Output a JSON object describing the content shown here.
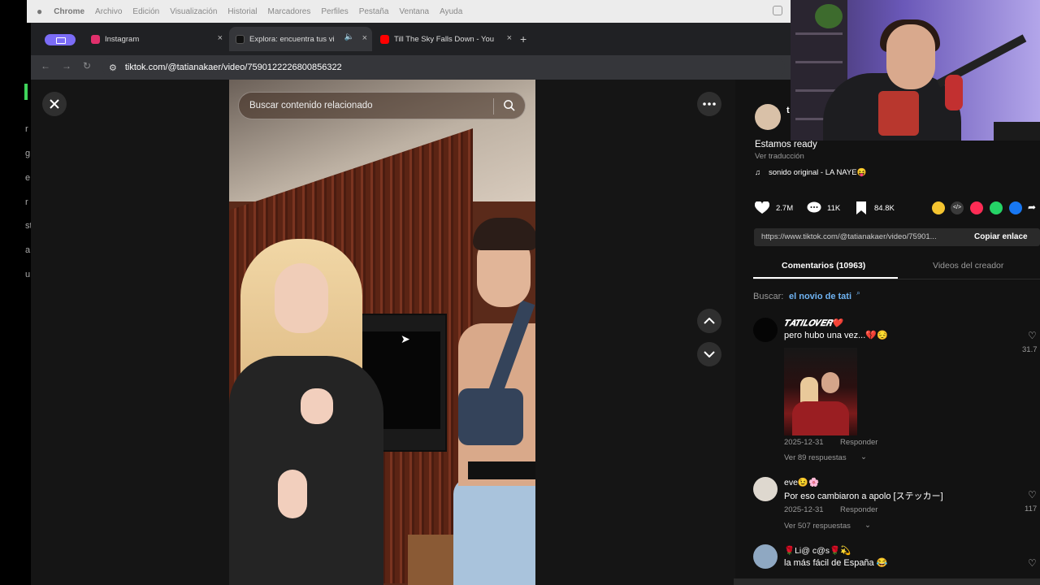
{
  "menubar": {
    "apple": "",
    "app_name": "Chrome",
    "items": [
      "Archivo",
      "Edición",
      "Visualización",
      "Historial",
      "Marcadores",
      "Perfiles",
      "Pestaña",
      "Ventana",
      "Ayuda"
    ]
  },
  "left_strip": {
    "chars": [
      "r",
      "g",
      "e",
      "r",
      "st",
      "a",
      "u"
    ]
  },
  "tabs": [
    {
      "label": "Instagram",
      "favicon_color": "#e1306c",
      "close": "×"
    },
    {
      "label": "Explora: encuentra tus vi",
      "favicon_color": "#111111",
      "close": "×",
      "audio_icon": "🔈"
    },
    {
      "label": "Till The Sky Falls Down - You",
      "favicon_color": "#ff0000",
      "close": "×"
    }
  ],
  "new_tab": "+",
  "nav": {
    "back": "←",
    "forward": "→",
    "reload": "↻"
  },
  "address": {
    "url": "tiktok.com/@tatianakaer/video/7590122226800856322"
  },
  "player": {
    "close_icon": "close-icon",
    "more_icon": "more-horizontal-icon",
    "search_placeholder": "Buscar contenido relacionado",
    "nav_up": "up-icon",
    "nav_down": "down-icon"
  },
  "post": {
    "author_initial": "t",
    "caption": "Estamos ready",
    "translate": "Ver traducción",
    "sound": "sonido original - LA NAYE😝",
    "likes": "2.7M",
    "comments": "11K",
    "saves": "84.8K",
    "copy_url": "https://www.tiktok.com/@tatianakaer/video/75901...",
    "copy_label": "Copiar enlace",
    "share_colors": [
      "#f4c430",
      "#3a3a3a",
      "#fe2c55",
      "#25d366",
      "#1877f2"
    ]
  },
  "panel_tabs": {
    "comments": "Comentarios (10963)",
    "creator_videos": "Videos del creador"
  },
  "search_prefix": "Buscar:",
  "search_term": "el novio de tati",
  "comments": [
    {
      "user": "𝑻𝑨𝑻𝑰𝑳𝑶𝑽𝑬𝑹❤️",
      "text": "pero hubo una vez...💔😔",
      "date": "2025-12-31",
      "reply": "Responder",
      "replies": "Ver 89 respuestas",
      "likes": "31.7"
    },
    {
      "user": "eve😉🌸",
      "text": "Por eso cambiaron a apolo [ステッカー]",
      "date": "2025-12-31",
      "reply": "Responder",
      "replies": "Ver 507 respuestas",
      "likes": "117"
    },
    {
      "user": "🌹Li@ c@s🌹💫",
      "text": "la más fácil de España 😂"
    }
  ]
}
